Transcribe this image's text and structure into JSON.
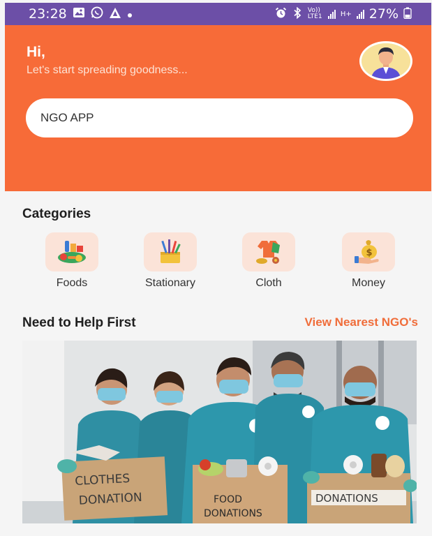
{
  "status_bar": {
    "time": "23:28",
    "battery": "27%",
    "network_label": "Vo)) LTE1",
    "network2_label": "H+",
    "icons": [
      "gallery-icon",
      "whatsapp-icon",
      "alert-triangle-icon",
      "dot-icon",
      "alarm-icon",
      "bluetooth-icon",
      "signal-icon",
      "battery-icon"
    ]
  },
  "header": {
    "greeting": "Hi,",
    "subtitle": "Let's start spreading goodness...",
    "search_value": "NGO APP",
    "colors": {
      "accent": "#f76b38",
      "status_bar": "#6c4fa7"
    }
  },
  "categories": {
    "title": "Categories",
    "items": [
      {
        "label": "Foods",
        "icon": "food-icon"
      },
      {
        "label": "Stationary",
        "icon": "stationary-icon"
      },
      {
        "label": "Cloth",
        "icon": "cloth-icon"
      },
      {
        "label": "Money",
        "icon": "money-icon"
      }
    ]
  },
  "help": {
    "title": "Need to Help First",
    "link": "View Nearest NGO's",
    "banner_signs": [
      "CLOTHES DONATION",
      "FOOD DONATIONS",
      "DONATIONS"
    ]
  }
}
